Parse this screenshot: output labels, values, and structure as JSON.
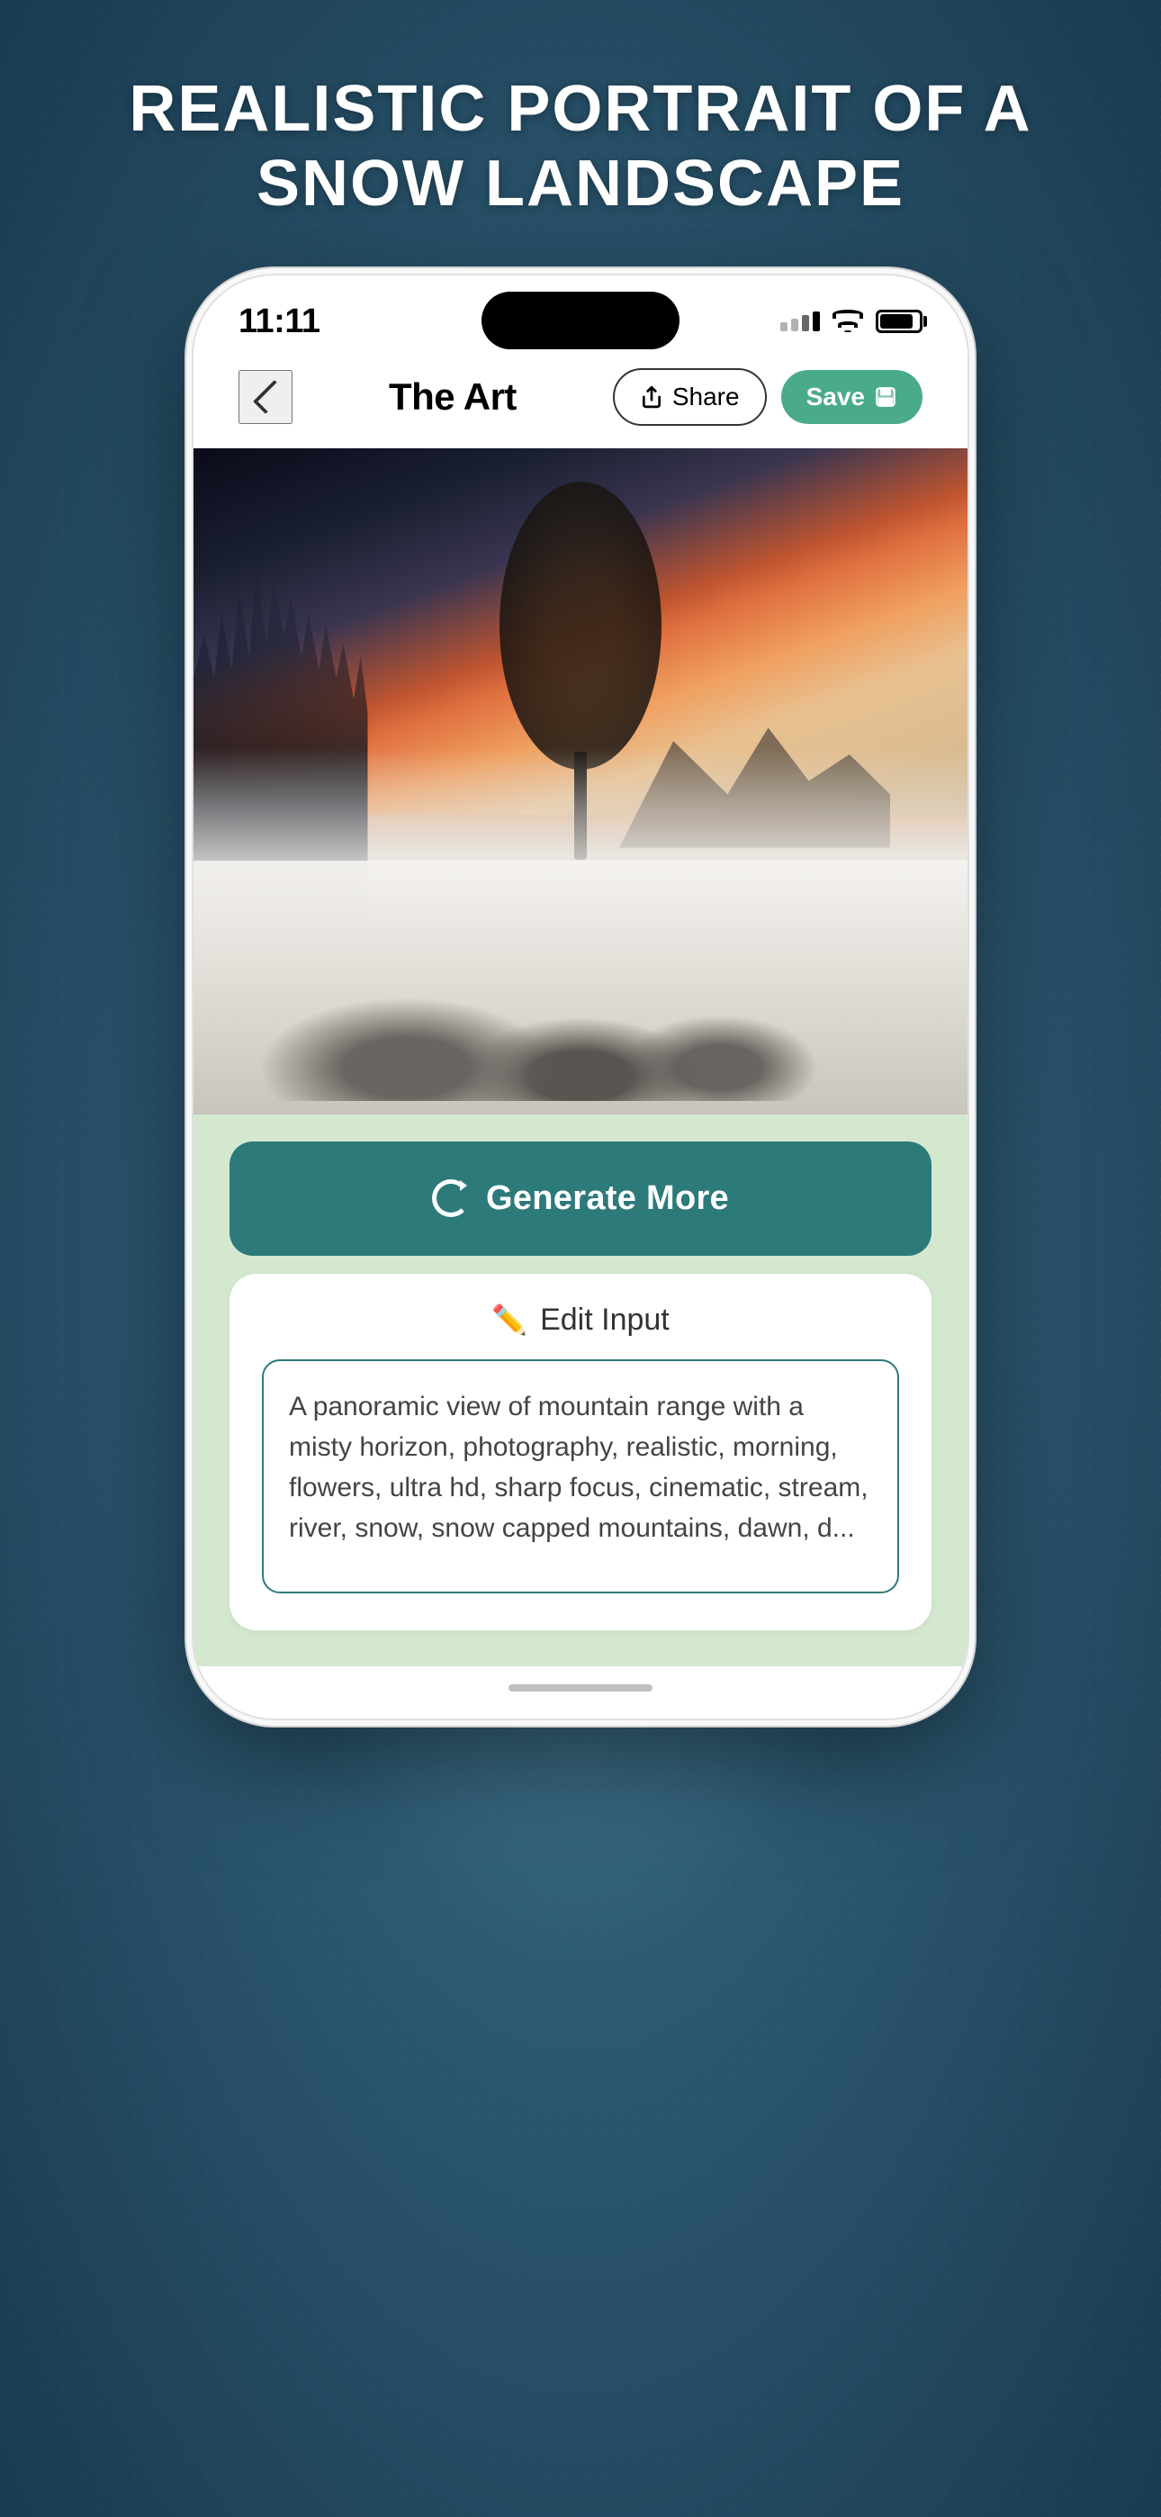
{
  "page": {
    "title": "REALISTIC PORTRAIT OF A\nSNOW LANDSCAPE",
    "background_color": "#2d5a72"
  },
  "status_bar": {
    "time": "11:11",
    "signal_label": "signal",
    "wifi_label": "wifi",
    "battery_label": "battery"
  },
  "nav": {
    "title": "The Art",
    "back_label": "Back",
    "share_label": "Share",
    "save_label": "Save"
  },
  "image": {
    "alt": "Realistic portrait of a snow landscape with misty morning scene, trees, and mountains"
  },
  "generate_btn": {
    "label": "Generate More",
    "icon": "refresh-icon"
  },
  "edit_input": {
    "title": "Edit Input",
    "pencil_icon": "pencil-icon",
    "prompt_text": "A panoramic view of mountain range with a misty horizon, photography, realistic, morning, flowers, ultra hd, sharp focus, cinematic, stream, river, snow, snow capped mountains, dawn, d..."
  }
}
